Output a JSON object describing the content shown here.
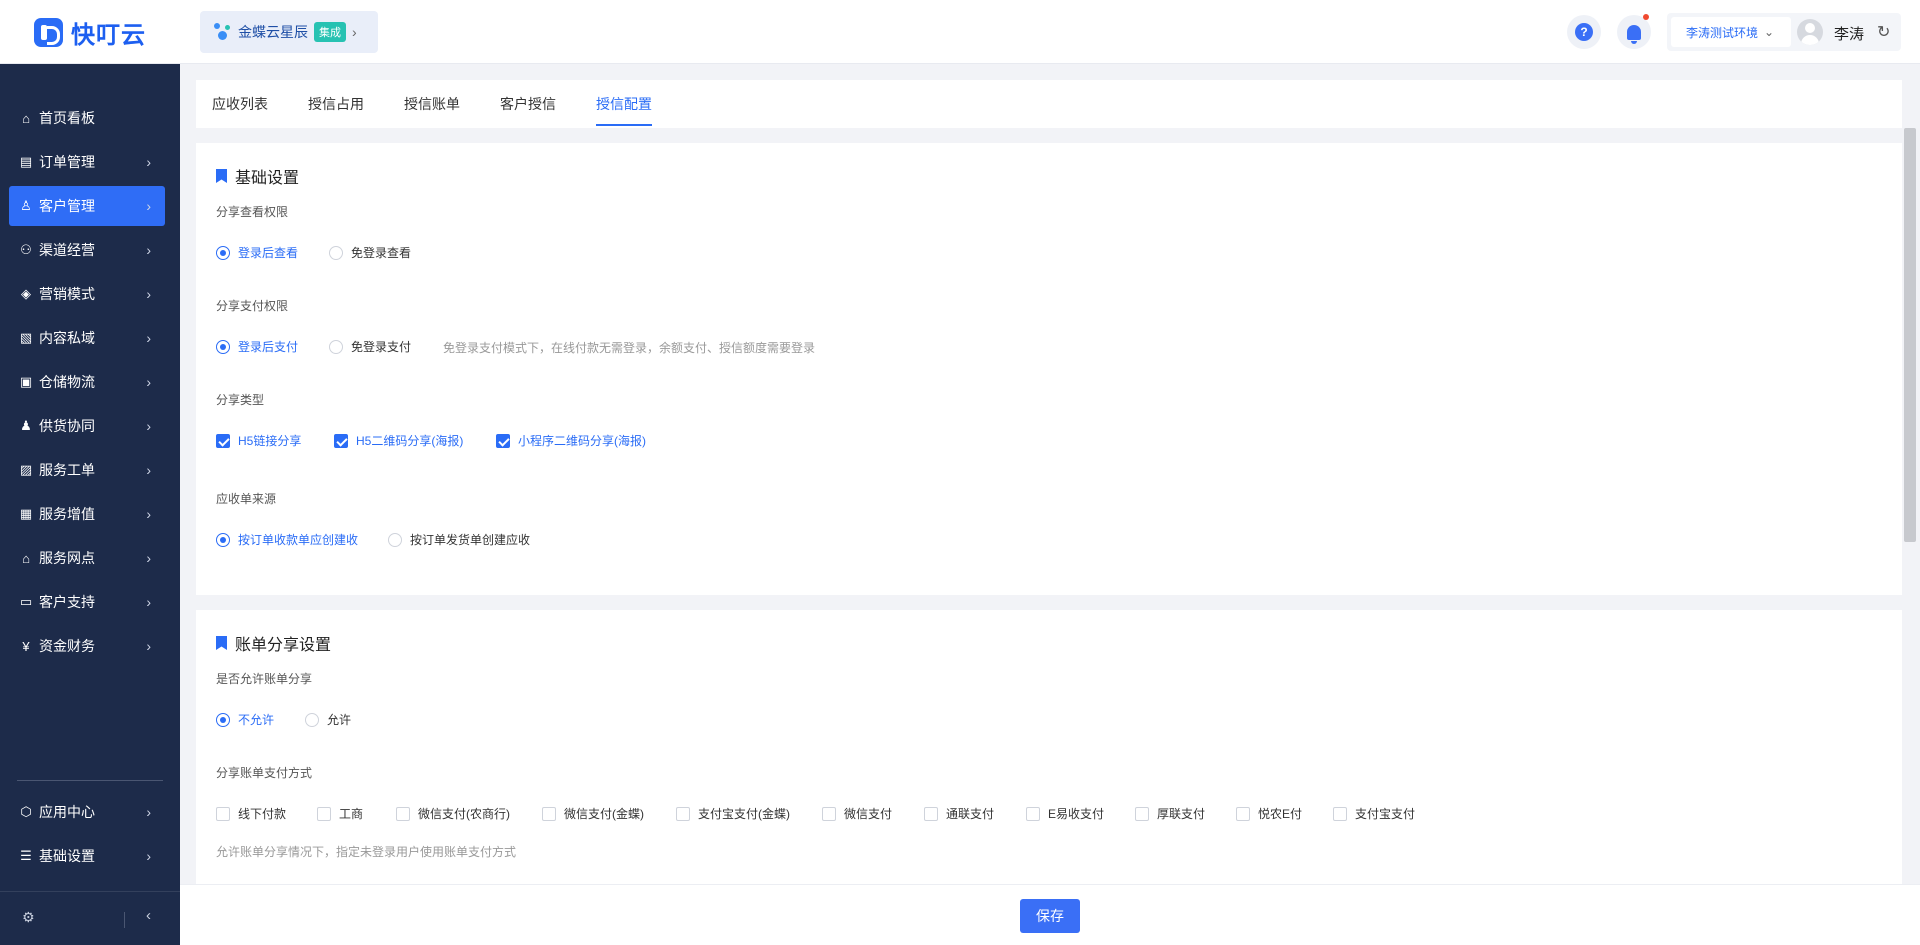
{
  "header": {
    "logo_text": "快叮云",
    "product": {
      "name": "金蝶云星辰",
      "badge": "集成",
      "arrow": "›"
    },
    "help_icon": "?",
    "env_label": "李涛测试环境",
    "env_chevron": "⌄",
    "user_name": "李涛",
    "refresh_icon": "↻"
  },
  "sidebar": {
    "items": [
      {
        "label": "首页看板",
        "icon": "home-icon",
        "glyph": "⌂",
        "has_children": false,
        "active": false
      },
      {
        "label": "订单管理",
        "icon": "order-icon",
        "glyph": "▤",
        "has_children": true,
        "active": false
      },
      {
        "label": "客户管理",
        "icon": "user-icon",
        "glyph": "♙",
        "has_children": true,
        "active": true
      },
      {
        "label": "渠道经营",
        "icon": "channel-icon",
        "glyph": "⚇",
        "has_children": true,
        "active": false
      },
      {
        "label": "营销模式",
        "icon": "tag-icon",
        "glyph": "◈",
        "has_children": true,
        "active": false
      },
      {
        "label": "内容私域",
        "icon": "image-icon",
        "glyph": "▧",
        "has_children": true,
        "active": false
      },
      {
        "label": "仓储物流",
        "icon": "box-icon",
        "glyph": "▣",
        "has_children": true,
        "active": false
      },
      {
        "label": "供货协同",
        "icon": "supplier-icon",
        "glyph": "♟",
        "has_children": true,
        "active": false
      },
      {
        "label": "服务工单",
        "icon": "ticket-icon",
        "glyph": "▨",
        "has_children": true,
        "active": false
      },
      {
        "label": "服务增值",
        "icon": "gift-icon",
        "glyph": "▦",
        "has_children": true,
        "active": false
      },
      {
        "label": "服务网点",
        "icon": "store-icon",
        "glyph": "⌂",
        "has_children": true,
        "active": false
      },
      {
        "label": "客户支持",
        "icon": "support-icon",
        "glyph": "▭",
        "has_children": true,
        "active": false
      },
      {
        "label": "资金财务",
        "icon": "yen-icon",
        "glyph": "¥",
        "has_children": true,
        "active": false
      }
    ],
    "bottom_items": [
      {
        "label": "应用中心",
        "icon": "app-center-icon",
        "glyph": "⬡",
        "has_children": true
      },
      {
        "label": "基础设置",
        "icon": "settings-list-icon",
        "glyph": "☰",
        "has_children": true
      }
    ],
    "chevron": "›",
    "gear_glyph": "⚙",
    "collapse_glyph": "‹"
  },
  "tabs": [
    {
      "label": "应收列表",
      "active": false
    },
    {
      "label": "授信占用",
      "active": false
    },
    {
      "label": "授信账单",
      "active": false
    },
    {
      "label": "客户授信",
      "active": false
    },
    {
      "label": "授信配置",
      "active": true
    }
  ],
  "basic_settings": {
    "title": "基础设置",
    "share_view": {
      "label": "分享查看权限",
      "options": [
        {
          "label": "登录后查看",
          "selected": true
        },
        {
          "label": "免登录查看",
          "selected": false
        }
      ]
    },
    "share_pay": {
      "label": "分享支付权限",
      "options": [
        {
          "label": "登录后支付",
          "selected": true
        },
        {
          "label": "免登录支付",
          "selected": false
        }
      ],
      "hint": "免登录支付模式下，在线付款无需登录，余额支付、授信额度需要登录"
    },
    "share_type": {
      "label": "分享类型",
      "options": [
        {
          "label": "H5链接分享",
          "checked": true
        },
        {
          "label": "H5二维码分享(海报)",
          "checked": true
        },
        {
          "label": "小程序二维码分享(海报)",
          "checked": true
        }
      ]
    },
    "receivable_source": {
      "label": "应收单来源",
      "options": [
        {
          "label": "按订单收款单应创建收",
          "selected": true
        },
        {
          "label": "按订单发货单创建应收",
          "selected": false
        }
      ]
    }
  },
  "bill_share": {
    "title": "账单分享设置",
    "allow_share": {
      "label": "是否允许账单分享",
      "options": [
        {
          "label": "不允许",
          "selected": true
        },
        {
          "label": "允许",
          "selected": false
        }
      ]
    },
    "pay_methods": {
      "label": "分享账单支付方式",
      "options": [
        {
          "label": "线下付款",
          "checked": false
        },
        {
          "label": "工商",
          "checked": false
        },
        {
          "label": "微信支付(农商行)",
          "checked": false
        },
        {
          "label": "微信支付(金蝶)",
          "checked": false
        },
        {
          "label": "支付宝支付(金蝶)",
          "checked": false
        },
        {
          "label": "微信支付",
          "checked": false
        },
        {
          "label": "通联支付",
          "checked": false
        },
        {
          "label": "E易收支付",
          "checked": false
        },
        {
          "label": "厚联支付",
          "checked": false
        },
        {
          "label": "悦农E付",
          "checked": false
        },
        {
          "label": "支付宝支付",
          "checked": false
        }
      ],
      "hint": "允许账单分享情况下，指定未登录用户使用账单支付方式"
    }
  },
  "footer": {
    "save_label": "保存"
  },
  "colors": {
    "primary": "#2a6cf6",
    "sidebar_bg": "#1d2b4a",
    "badge": "#27c2b2",
    "notification": "#f0492f"
  }
}
